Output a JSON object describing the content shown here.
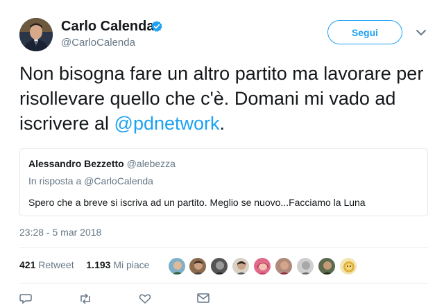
{
  "author": {
    "display_name": "Carlo Calenda",
    "handle": "@CarloCalenda"
  },
  "follow_button_label": "Segui",
  "tweet": {
    "text_before": "Non bisogna fare un altro partito ma lavorare per risollevare quello che c'è. Domani mi vado ad iscrivere al ",
    "mention": "@pdnetwork",
    "text_after": "."
  },
  "quote": {
    "author_name": "Alessandro Bezzetto",
    "author_handle": "@alebezza",
    "reply_to": "In risposta a @CarloCalenda",
    "text": "Spero che a breve si iscriva ad un partito. Meglio se nuovo...Facciamo la Luna"
  },
  "timestamp": "23:28 - 5 mar 2018",
  "stats": {
    "retweets_count": "421",
    "retweets_label": "Retweet",
    "likes_count": "1.193",
    "likes_label": "Mi piace"
  },
  "colors": {
    "accent": "#1da1f2",
    "muted": "#657786",
    "text": "#14171a",
    "border": "#e1e8ed"
  },
  "icons": {
    "verified": "verified-badge-icon",
    "more": "chevron-down-icon",
    "reply": "reply-icon",
    "retweet": "retweet-icon",
    "like": "heart-icon",
    "message": "envelope-icon"
  },
  "liker_avatars": [
    "avatar-1",
    "avatar-2",
    "avatar-3",
    "avatar-4",
    "avatar-5",
    "avatar-6",
    "avatar-7",
    "avatar-8",
    "avatar-9"
  ]
}
